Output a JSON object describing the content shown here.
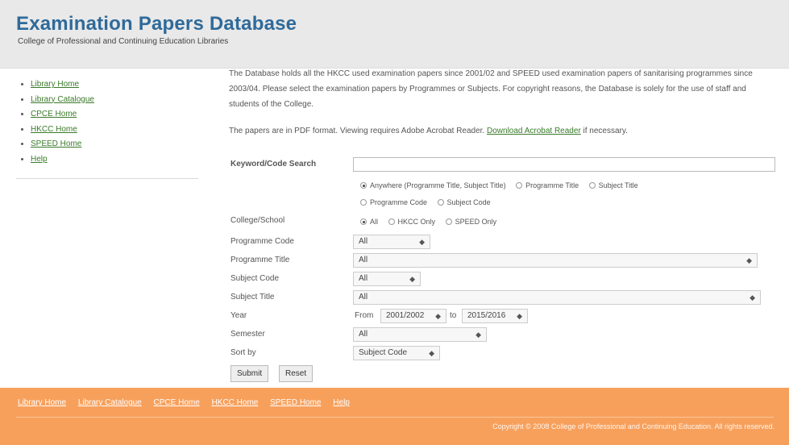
{
  "header": {
    "title": "Examination Papers Database",
    "subtitle": "College of Professional and Continuing Education Libraries"
  },
  "sidebar": {
    "items": [
      {
        "label": "Library Home"
      },
      {
        "label": "Library Catalogue"
      },
      {
        "label": "CPCE Home"
      },
      {
        "label": "HKCC Home"
      },
      {
        "label": "SPEED Home"
      },
      {
        "label": "Help"
      }
    ]
  },
  "intro": {
    "text": "The Database holds all the HKCC used examination papers since 2001/02 and SPEED used examination papers of sanitarising programmes since 2003/04. Please select the examination papers by Programmes or Subjects. For copyright reasons, the Database is solely for the use of staff and students of the College.",
    "pdf_text": "The papers are in PDF format. Viewing requires Adobe Acrobat Reader.",
    "pdf_link": "Download Acrobat Reader",
    "pdf_suffix": "if necessary."
  },
  "form": {
    "keyword_label": "Keyword/Code Search",
    "keyword_value": "",
    "search_options": [
      "Anywhere (Programme Title, Subject Title)",
      "Programme Title",
      "Subject Title",
      "Programme Code",
      "Subject Code"
    ],
    "school_label": "College/School",
    "school_options": [
      "All",
      "HKCC Only",
      "SPEED Only"
    ],
    "prog_code_label": "Programme Code",
    "prog_code_value": "All",
    "prog_title_label": "Programme Title",
    "prog_title_value": "All",
    "subj_code_label": "Subject Code",
    "subj_code_value": "All",
    "subj_title_label": "Subject Title",
    "subj_title_value": "All",
    "year_label": "Year",
    "year_from_text": "From",
    "year_from_value": "2001/2002",
    "year_to_text": "to",
    "year_to_value": "2015/2016",
    "semester_label": "Semester",
    "semester_value": "All",
    "sort_label": "Sort by",
    "sort_value": "Subject Code",
    "submit_label": "Submit",
    "reset_label": "Reset"
  },
  "footer": {
    "links": [
      "Library Home",
      "Library Catalogue",
      "CPCE Home",
      "HKCC Home",
      "SPEED Home",
      "Help"
    ],
    "copyright": "Copyright © 2008 College of Professional and Continuing Education. All rights reserved."
  },
  "colors": {
    "title": "#2f6a9a",
    "link": "#3a7a2a",
    "footer_bg": "#f7a05c",
    "header_bg": "#e9e9e9"
  }
}
